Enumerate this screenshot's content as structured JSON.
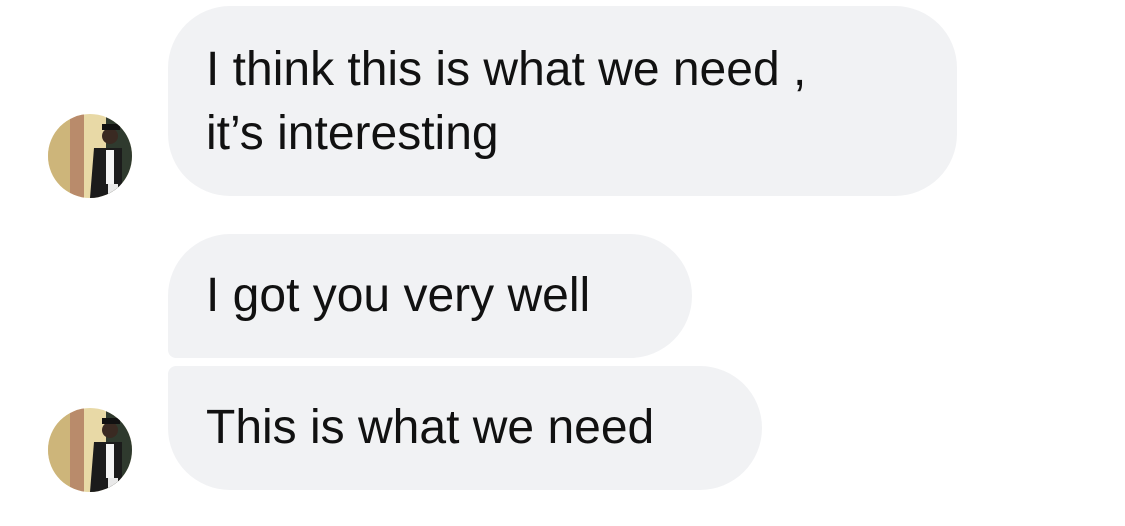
{
  "messages": [
    {
      "lines": [
        "I think this is what we need ,",
        "it’s interesting"
      ]
    },
    {
      "text": "I got you very well"
    },
    {
      "text": "This is what we need"
    }
  ],
  "avatar": {
    "icon": "user-avatar-photo"
  },
  "colors": {
    "bubble": "#f1f2f4",
    "text": "#111111",
    "background": "#ffffff"
  }
}
